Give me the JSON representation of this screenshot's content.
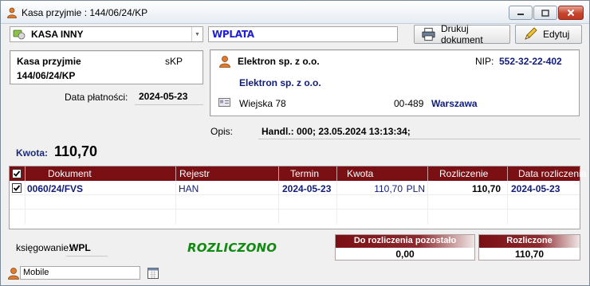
{
  "window": {
    "title": "Kasa przyjmie : 144/06/24/KP",
    "min_label": "–",
    "max_label": "□",
    "close_label": "✕"
  },
  "toolbar": {
    "register": "KASA INNY",
    "type": "WPLATA",
    "print_label": "Drukuj dokument",
    "edit_label": "Edytuj"
  },
  "document": {
    "type": "Kasa przyjmie",
    "sign": "sKP",
    "number": "144/06/24/KP",
    "payment_date_label": "Data płatności:",
    "payment_date": "2024-05-23"
  },
  "contractor": {
    "name": "Elektron sp. z o.o.",
    "nip_label": "NIP:",
    "nip": "552-32-22-402",
    "full_name": "Elektron sp. z o.o.",
    "street": "Wiejska 78",
    "postcode": "00-489",
    "city": "Warszawa"
  },
  "description": {
    "label": "Opis:",
    "value": "Handl.: 000; 23.05.2024 13:13:34;"
  },
  "amount": {
    "label": "Kwota:",
    "value": "110,70"
  },
  "table": {
    "headers": [
      "Dokument",
      "Rejestr",
      "Termin",
      "Kwota",
      "Rozliczenie",
      "Data rozliczenia"
    ],
    "rows": [
      {
        "checked": true,
        "document": "0060/24/FVS",
        "register": "HAN",
        "due": "2024-05-23",
        "amount": "110,70",
        "currency": "PLN",
        "settlement": "110,70",
        "settlement_date": "2024-05-23"
      }
    ]
  },
  "footer": {
    "booking_label": "księgowanie:",
    "booking_value": "WPL",
    "stamp": "ROZLICZONO",
    "remaining_label": "Do rozliczenia pozostało",
    "remaining_value": "0,00",
    "settled_label": "Rozliczone",
    "settled_value": "110,70"
  },
  "statusbar": {
    "user": "Mobile"
  },
  "colors": {
    "grid_header": "#7a0f14",
    "accent_blue": "#101c7a",
    "type_blue": "#1e1ed2",
    "stamp_green": "#118a11"
  }
}
